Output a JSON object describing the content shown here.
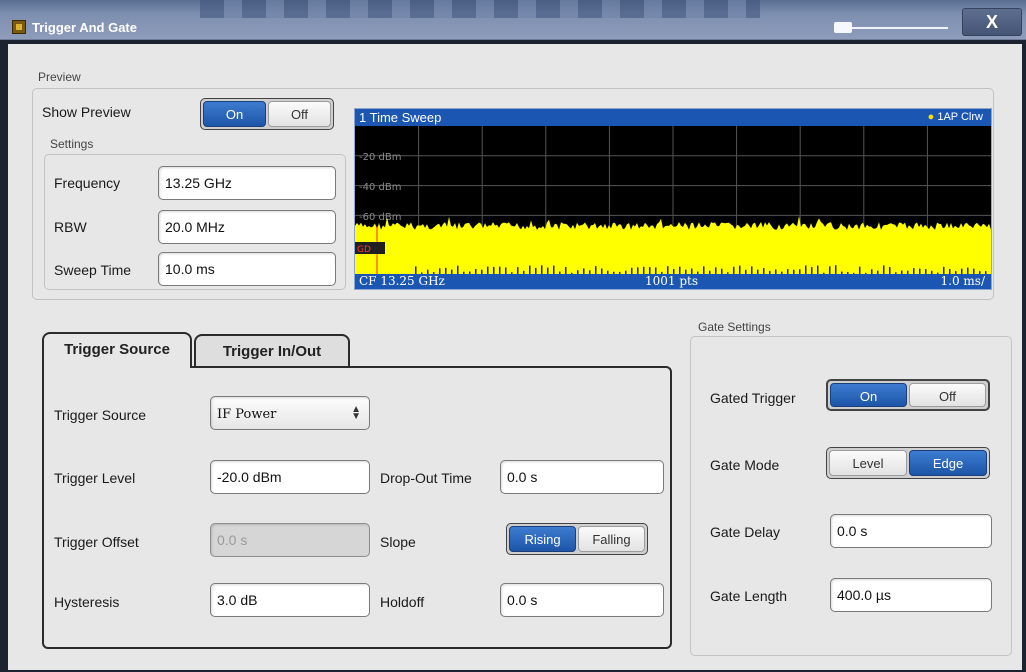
{
  "window": {
    "title": "Trigger And Gate",
    "close_label": "X"
  },
  "preview": {
    "group_label": "Preview",
    "show_preview_label": "Show Preview",
    "show_preview_toggle": {
      "on": "On",
      "off": "Off",
      "selected": "On"
    },
    "settings_label": "Settings",
    "frequency_label": "Frequency",
    "frequency_value": "13.25 GHz",
    "rbw_label": "RBW",
    "rbw_value": "20.0 MHz",
    "sweep_time_label": "Sweep Time",
    "sweep_time_value": "10.0 ms"
  },
  "trace": {
    "title": "1 Time Sweep",
    "trace_info": "1AP Clrw",
    "y_labels": [
      "-20 dBm",
      "-40 dBm",
      "-60 dBm"
    ],
    "center_freq": "CF 13.25 GHz",
    "points": "1001 pts",
    "scale": "1.0 ms/",
    "gate_marker": "GD",
    "colors": {
      "trace": "#ffff00",
      "grid": "#555555",
      "header": "#1c56b3",
      "trigger_line": "#ff2020"
    }
  },
  "tabs": {
    "trigger_source": "Trigger Source",
    "trigger_in_out": "Trigger In/Out",
    "active": "Trigger Source"
  },
  "trigger": {
    "source_label": "Trigger Source",
    "source_value": "IF Power",
    "level_label": "Trigger Level",
    "level_value": "-20.0 dBm",
    "dropout_label": "Drop-Out Time",
    "dropout_value": "0.0 s",
    "offset_label": "Trigger Offset",
    "offset_value": "0.0 s",
    "slope_label": "Slope",
    "slope_toggle": {
      "rising": "Rising",
      "falling": "Falling",
      "selected": "Rising"
    },
    "hysteresis_label": "Hysteresis",
    "hysteresis_value": "3.0 dB",
    "holdoff_label": "Holdoff",
    "holdoff_value": "0.0 s"
  },
  "gate": {
    "group_label": "Gate Settings",
    "gated_trigger_label": "Gated Trigger",
    "gated_trigger_toggle": {
      "on": "On",
      "off": "Off",
      "selected": "On"
    },
    "mode_label": "Gate Mode",
    "mode_toggle": {
      "level": "Level",
      "edge": "Edge",
      "selected": "Edge"
    },
    "delay_label": "Gate Delay",
    "delay_value": "0.0 s",
    "length_label": "Gate Length",
    "length_value": "400.0 µs"
  }
}
